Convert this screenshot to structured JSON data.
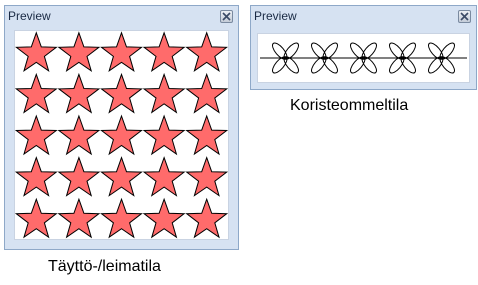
{
  "panels": [
    {
      "title": "Preview",
      "close_icon": "close-icon",
      "content_icon": "star-icon",
      "star_color": "#ff6b6b",
      "star_grid": {
        "rows": 5,
        "cols": 5
      },
      "caption": "Täyttö-/leimatila"
    },
    {
      "title": "Preview",
      "close_icon": "close-icon",
      "content_icon": "flower-motif-icon",
      "motif_count": 5,
      "caption": "Koristeommeltila"
    }
  ],
  "colors": {
    "panel_bg": "#d6e2f2",
    "panel_border": "#8ea8c8",
    "star_fill": "#ff6b6b",
    "star_stroke": "#000000"
  }
}
